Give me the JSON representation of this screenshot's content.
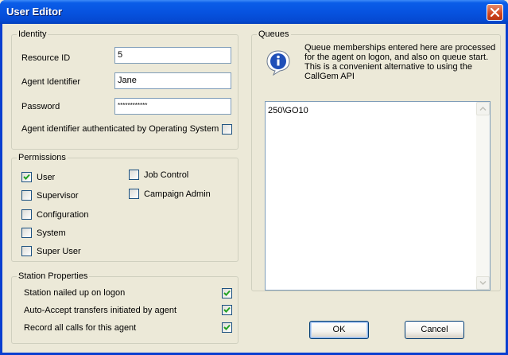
{
  "window": {
    "title": "User Editor"
  },
  "identity": {
    "legend": "Identity",
    "resource_id_label": "Resource ID",
    "resource_id_value": "5",
    "agent_identifier_label": "Agent Identifier",
    "agent_identifier_value": "Jane",
    "password_label": "Password",
    "password_value": "************",
    "os_auth_label": "Agent identifier authenticated by Operating System",
    "os_auth_checked": false
  },
  "permissions": {
    "legend": "Permissions",
    "items": [
      {
        "label": "User",
        "checked": true
      },
      {
        "label": "Supervisor",
        "checked": false
      },
      {
        "label": "Configuration",
        "checked": false
      },
      {
        "label": "System",
        "checked": false
      },
      {
        "label": "Super User",
        "checked": false
      },
      {
        "label": "Job Control",
        "checked": false
      },
      {
        "label": "Campaign Admin",
        "checked": false
      }
    ]
  },
  "station": {
    "legend": "Station Properties",
    "items": [
      {
        "label": "Station nailed up on logon",
        "checked": true
      },
      {
        "label": "Auto-Accept transfers initiated by agent",
        "checked": true
      },
      {
        "label": "Record all calls for this agent",
        "checked": true
      }
    ]
  },
  "queues": {
    "legend": "Queues",
    "info_line1": "Queue memberships entered here are processed",
    "info_line2": "for the agent on logon, and also on queue start.",
    "info_line3": "This is a convenient alternative to using the",
    "info_line4": "CallGem API",
    "entries": [
      "250\\GO10"
    ]
  },
  "buttons": {
    "ok": "OK",
    "cancel": "Cancel"
  },
  "icons": {
    "info": "info-icon",
    "close": "close-icon",
    "check": "check-icon"
  },
  "colors": {
    "titlebar": "#0753e0",
    "face": "#ece9d8",
    "check": "#21a121"
  }
}
